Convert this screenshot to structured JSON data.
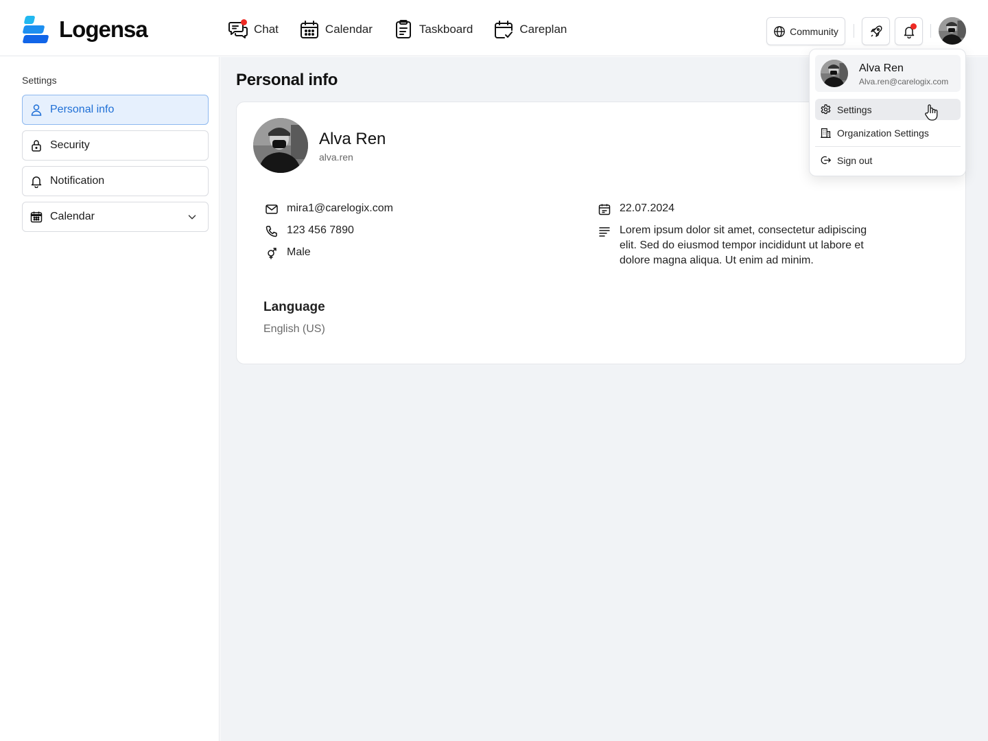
{
  "brand": {
    "name": "Logensa",
    "colors": [
      "#22b8f0",
      "#1d8ff0",
      "#1165e8"
    ]
  },
  "nav": [
    {
      "label": "Chat",
      "icon": "chat-icon",
      "has_badge": true
    },
    {
      "label": "Calendar",
      "icon": "calendar-icon",
      "has_badge": false
    },
    {
      "label": "Taskboard",
      "icon": "clipboard-icon",
      "has_badge": false
    },
    {
      "label": "Careplan",
      "icon": "calendar-check-icon",
      "has_badge": false
    }
  ],
  "header": {
    "community_label": "Community",
    "rocket_icon": "rocket-icon",
    "bell_icon": "bell-icon",
    "notification_dot_color": "#ee2a24"
  },
  "sidebar": {
    "title": "Settings",
    "items": [
      {
        "label": "Personal info",
        "icon": "user-icon",
        "active": true
      },
      {
        "label": "Security",
        "icon": "lock-icon",
        "active": false
      },
      {
        "label": "Notification",
        "icon": "bell-icon",
        "active": false
      },
      {
        "label": "Calendar",
        "icon": "calendar-icon",
        "active": false,
        "expandable": true
      }
    ],
    "accent_color": "#1e6fd6"
  },
  "main": {
    "page_title": "Personal info",
    "profile": {
      "name": "Alva Ren",
      "username": "alva.ren",
      "email": "mira1@carelogix.com",
      "phone": "123 456 7890",
      "gender": "Male",
      "date": "22.07.2024",
      "bio": "Lorem ipsum dolor sit amet, consectetur adipiscing elit. Sed do eiusmod tempor incididunt ut labore et dolore magna aliqua. Ut enim ad minim."
    },
    "language": {
      "label": "Language",
      "value": "English (US)"
    }
  },
  "account_menu": {
    "name": "Alva Ren",
    "email": "Alva.ren@carelogix.com",
    "items": [
      {
        "label": "Settings",
        "icon": "gear-icon",
        "hovered": true
      },
      {
        "label": "Organization Settings",
        "icon": "building-icon",
        "hovered": false
      },
      {
        "label": "Sign out",
        "icon": "sign-out-icon",
        "hovered": false
      }
    ]
  }
}
